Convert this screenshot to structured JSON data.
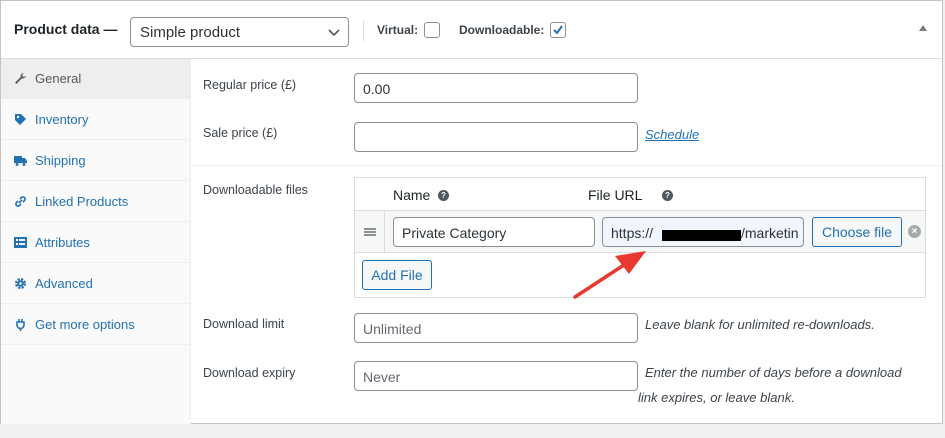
{
  "header": {
    "title": "Product data —",
    "product_type": "Simple product",
    "virtual_label": "Virtual:",
    "virtual_checked": false,
    "downloadable_label": "Downloadable:",
    "downloadable_checked": true
  },
  "tabs": [
    {
      "label": "General",
      "icon": "wrench-icon",
      "active": true
    },
    {
      "label": "Inventory",
      "icon": "tag-icon",
      "active": false
    },
    {
      "label": "Shipping",
      "icon": "truck-icon",
      "active": false
    },
    {
      "label": "Linked Products",
      "icon": "link-icon",
      "active": false
    },
    {
      "label": "Attributes",
      "icon": "list-icon",
      "active": false
    },
    {
      "label": "Advanced",
      "icon": "gear-icon",
      "active": false
    },
    {
      "label": "Get more options",
      "icon": "plugin-icon",
      "active": false
    }
  ],
  "general": {
    "regular_price_label": "Regular price (£)",
    "regular_price_value": "0.00",
    "sale_price_label": "Sale price (£)",
    "sale_price_value": "",
    "schedule_link": "Schedule",
    "downloadable_files_label": "Downloadable files",
    "files_table": {
      "name_header": "Name",
      "url_header": "File URL",
      "rows": [
        {
          "name": "Private Category",
          "url_start": "https://",
          "url_end": "/marketin"
        }
      ],
      "choose_file_label": "Choose file",
      "add_file_label": "Add File"
    },
    "download_limit_label": "Download limit",
    "download_limit_placeholder": "Unlimited",
    "download_limit_hint": "Leave blank for unlimited re-downloads.",
    "download_expiry_label": "Download expiry",
    "download_expiry_placeholder": "Never",
    "download_expiry_hint_line1": "Enter the number of days before a download",
    "download_expiry_hint_line2": "link expires, or leave blank."
  },
  "colors": {
    "link": "#2271b1",
    "annotation_arrow": "#e8382f",
    "active_tab_bg": "#eeeeee"
  }
}
